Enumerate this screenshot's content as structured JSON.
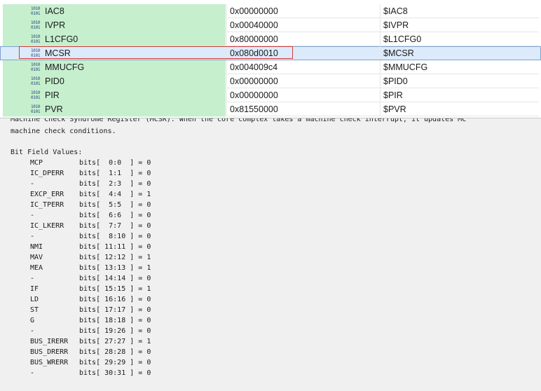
{
  "registers": [
    {
      "name": "IAC8",
      "value": "0x00000000",
      "alias": "$IAC8",
      "selected": false
    },
    {
      "name": "IVPR",
      "value": "0x00040000",
      "alias": "$IVPR",
      "selected": false
    },
    {
      "name": "L1CFG0",
      "value": "0x80000000",
      "alias": "$L1CFG0",
      "selected": false
    },
    {
      "name": "MCSR",
      "value": "0x080d0010",
      "alias": "$MCSR",
      "selected": true
    },
    {
      "name": "MMUCFG",
      "value": "0x004009c4",
      "alias": "$MMUCFG",
      "selected": false
    },
    {
      "name": "PID0",
      "value": "0x00000000",
      "alias": "$PID0",
      "selected": false
    },
    {
      "name": "PIR",
      "value": "0x00000000",
      "alias": "$PIR",
      "selected": false
    },
    {
      "name": "PVR",
      "value": "0x81550000",
      "alias": "$PVR",
      "selected": false
    }
  ],
  "register_icon": {
    "line1": "1010",
    "line2": "0101",
    "semantic": "binary-register-icon"
  },
  "description": {
    "clipped_line": "Machine Check Syndrome Register (MCSR). When the core complex takes a machine check interrupt, it updates MC",
    "line2": "machine check conditions."
  },
  "bit_fields": {
    "heading": "Bit Field Values:",
    "rows": [
      {
        "name": "MCP",
        "bits": "bits[  0:0  ] = 0"
      },
      {
        "name": "IC_DPERR",
        "bits": "bits[  1:1  ] = 0"
      },
      {
        "name": "-",
        "bits": "bits[  2:3  ] = 0"
      },
      {
        "name": "EXCP_ERR",
        "bits": "bits[  4:4  ] = 1"
      },
      {
        "name": "IC_TPERR",
        "bits": "bits[  5:5  ] = 0"
      },
      {
        "name": "-",
        "bits": "bits[  6:6  ] = 0"
      },
      {
        "name": "IC_LKERR",
        "bits": "bits[  7:7  ] = 0"
      },
      {
        "name": "-",
        "bits": "bits[  8:10 ] = 0"
      },
      {
        "name": "NMI",
        "bits": "bits[ 11:11 ] = 0"
      },
      {
        "name": "MAV",
        "bits": "bits[ 12:12 ] = 1"
      },
      {
        "name": "MEA",
        "bits": "bits[ 13:13 ] = 1"
      },
      {
        "name": "-",
        "bits": "bits[ 14:14 ] = 0"
      },
      {
        "name": "IF",
        "bits": "bits[ 15:15 ] = 1"
      },
      {
        "name": "LD",
        "bits": "bits[ 16:16 ] = 0"
      },
      {
        "name": "ST",
        "bits": "bits[ 17:17 ] = 0"
      },
      {
        "name": "G",
        "bits": "bits[ 18:18 ] = 0"
      },
      {
        "name": "-",
        "bits": "bits[ 19:26 ] = 0"
      },
      {
        "name": "BUS_IRERR",
        "bits": "bits[ 27:27 ] = 1"
      },
      {
        "name": "BUS_DRERR",
        "bits": "bits[ 28:28 ] = 0"
      },
      {
        "name": "BUS_WRERR",
        "bits": "bits[ 29:29 ] = 0"
      },
      {
        "name": "-",
        "bits": "bits[ 30:31 ] = 0"
      }
    ]
  },
  "colors": {
    "name_column_bg": "#c6efce",
    "selected_row_bg": "#dcebfb",
    "highlight_box": "#d03b3b",
    "detail_bg": "#f0f0f0"
  }
}
